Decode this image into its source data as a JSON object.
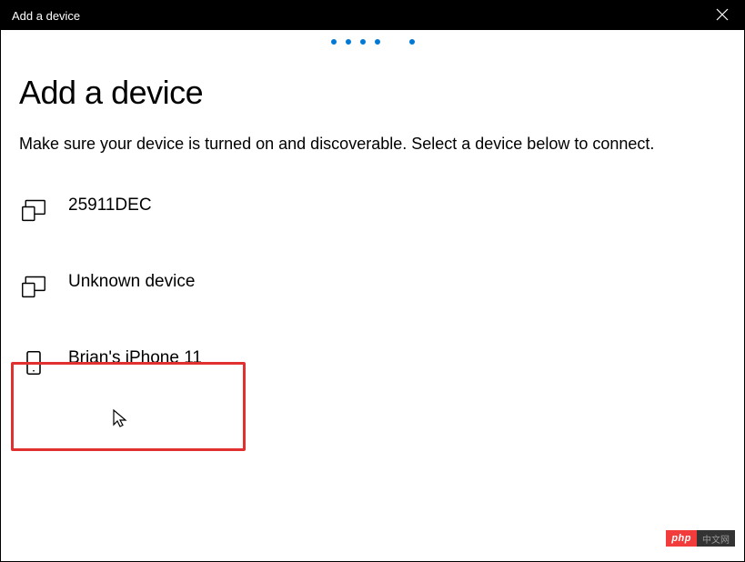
{
  "titlebar": {
    "title": "Add a device"
  },
  "main": {
    "heading": "Add a device",
    "subheading": "Make sure your device is turned on and discoverable. Select a device below to connect."
  },
  "devices": [
    {
      "name": "25911DEC",
      "icon": "displays-icon"
    },
    {
      "name": "Unknown device",
      "icon": "displays-icon"
    },
    {
      "name": "Brian's iPhone 11",
      "icon": "phone-icon"
    }
  ],
  "badge": {
    "php": "php",
    "dark": "中文网"
  }
}
